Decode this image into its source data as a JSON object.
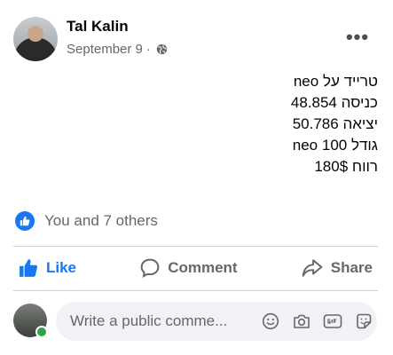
{
  "post": {
    "author": "Tal Kalin",
    "date": "September 9",
    "separator": "·",
    "privacy_icon": "globe-icon",
    "more_label": "•••",
    "lines": [
      "טרייד על neo",
      "כניסה 48.854",
      "יציאה 50.786",
      "גודל 100 neo",
      "רווח 180$"
    ]
  },
  "reactions": {
    "summary": "You and 7 others",
    "icon": "like-badge-icon"
  },
  "actions": {
    "like": "Like",
    "comment": "Comment",
    "share": "Share"
  },
  "comment_box": {
    "placeholder": "Write a public comme..."
  },
  "colors": {
    "brand_blue": "#1877f2",
    "secondary_text": "#65676b",
    "divider": "#ced0d4",
    "input_bg": "#f0f2f5",
    "online": "#31a24c"
  }
}
